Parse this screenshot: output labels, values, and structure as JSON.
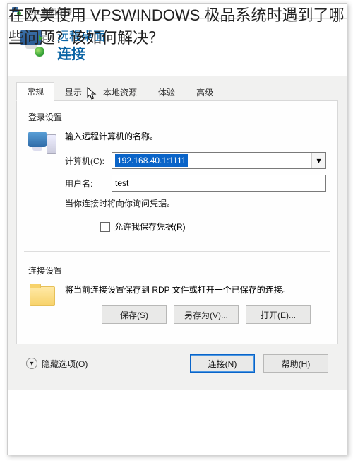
{
  "overlay_title": "在欧美使用 VPSWINDOWS 极品系统时遇到了哪些问题？该如何解决？",
  "window": {
    "title": "远程桌面连接"
  },
  "header": {
    "line1": "远程桌面",
    "line2": "连接"
  },
  "tabs": [
    {
      "label": "常规",
      "active": true
    },
    {
      "label": "显示",
      "active": false
    },
    {
      "label": "本地资源",
      "active": false
    },
    {
      "label": "体验",
      "active": false
    },
    {
      "label": "高级",
      "active": false
    }
  ],
  "login_settings": {
    "group_title": "登录设置",
    "instruction": "输入远程计算机的名称。",
    "computer_label": "计算机(C):",
    "computer_value": "192.168.40.1:1111",
    "username_label": "用户名:",
    "username_value": "test",
    "credentials_hint": "当你连接时将向你询问凭据。",
    "remember_checkbox": "允许我保存凭据(R)",
    "remember_checked": false
  },
  "connection_settings": {
    "group_title": "连接设置",
    "description": "将当前连接设置保存到 RDP 文件或打开一个已保存的连接。",
    "buttons": {
      "save": "保存(S)",
      "save_as": "另存为(V)...",
      "open": "打开(E)..."
    }
  },
  "footer": {
    "hide_options": "隐藏选项(O)",
    "connect": "连接(N)",
    "help": "帮助(H)"
  },
  "icons": {
    "app": "rdp-icon",
    "chevron_down": "▾",
    "collapse": "▾"
  }
}
